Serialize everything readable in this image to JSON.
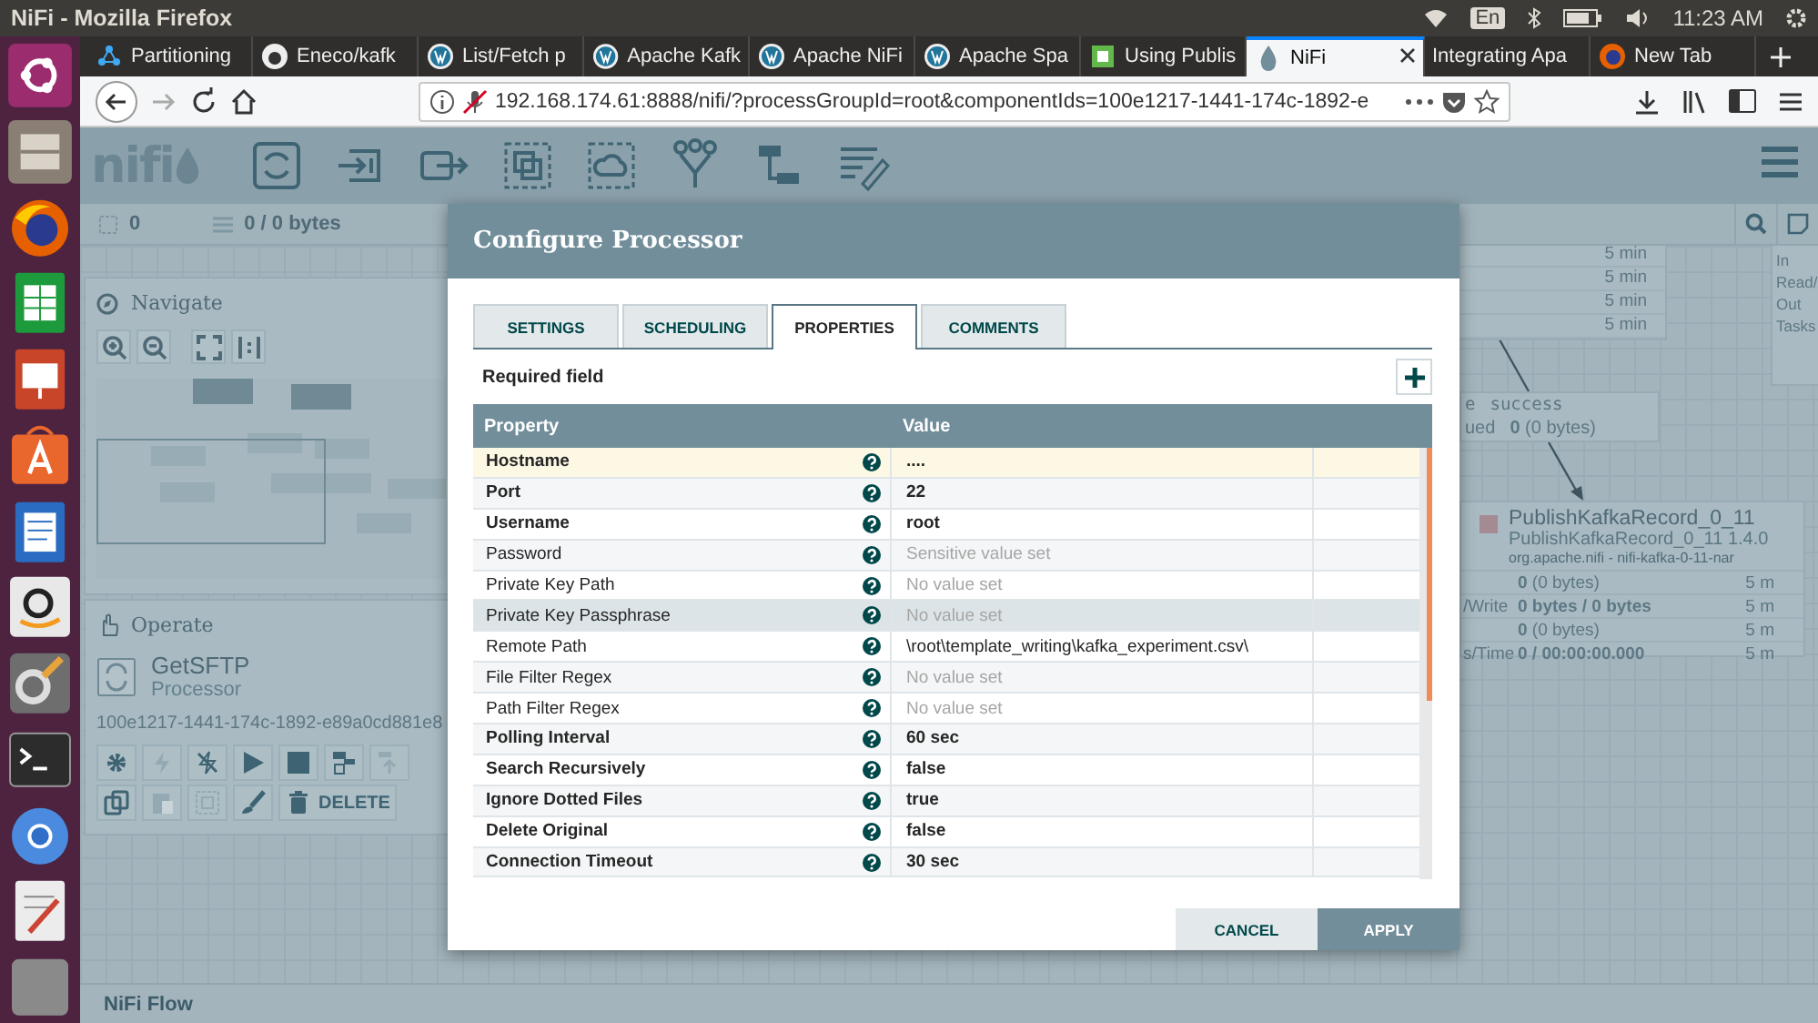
{
  "desktop": {
    "title": "NiFi - Mozilla Firefox",
    "keyboard": "En",
    "time": "11:23 AM"
  },
  "launcher": [
    {
      "kind": "dash"
    },
    {
      "kind": "files"
    },
    {
      "kind": "firefox"
    },
    {
      "kind": "calc"
    },
    {
      "kind": "impress"
    },
    {
      "kind": "software"
    },
    {
      "kind": "writer"
    },
    {
      "kind": "amazon"
    },
    {
      "kind": "settings"
    },
    {
      "kind": "terminal"
    },
    {
      "kind": "chromium"
    },
    {
      "kind": "editor"
    },
    {
      "kind": "trash"
    }
  ],
  "browser": {
    "tabs": [
      {
        "label": "Partitioning",
        "kind": "cluster",
        "selected": false
      },
      {
        "label": "Eneco/kafk",
        "kind": "github",
        "selected": false
      },
      {
        "label": "List/Fetch p",
        "kind": "wordpress",
        "selected": false
      },
      {
        "label": "Apache Kafk",
        "kind": "wordpress",
        "selected": false
      },
      {
        "label": "Apache NiFi",
        "kind": "wordpress",
        "selected": false
      },
      {
        "label": "Apache Spa",
        "kind": "wordpress",
        "selected": false
      },
      {
        "label": "Using Publis",
        "kind": "leaf",
        "selected": false
      },
      {
        "label": "NiFi",
        "kind": "drop",
        "selected": true
      },
      {
        "label": "Integrating Apa",
        "kind": "plain",
        "selected": false
      },
      {
        "label": "New Tab",
        "kind": "firefox",
        "selected": false
      }
    ],
    "url": "192.168.174.61:8888/nifi/?processGroupId=root&componentIds=100e1217-1441-174c-1892-e"
  },
  "nifi": {
    "logo": "nifi",
    "tools": [
      {
        "kind": "processor"
      },
      {
        "kind": "input-port"
      },
      {
        "kind": "output-port"
      },
      {
        "kind": "process-group"
      },
      {
        "kind": "remote-group"
      },
      {
        "kind": "funnel"
      },
      {
        "kind": "template"
      },
      {
        "kind": "label"
      }
    ],
    "stats": [
      {
        "kind": "components",
        "value": "0"
      },
      {
        "kind": "queued",
        "value": "0 / 0 bytes"
      }
    ],
    "navigate": {
      "title": "Navigate",
      "buttons": [
        {
          "kind": "zoom-in"
        },
        {
          "kind": "zoom-out"
        },
        {
          "kind": "fit"
        },
        {
          "kind": "actual-size"
        }
      ]
    },
    "operate": {
      "title": "Operate",
      "component": {
        "name": "GetSFTP",
        "type": "Processor",
        "id": "100e1217-1441-174c-1892-e89a0cd881e8"
      },
      "rows": [
        [
          {
            "kind": "gear",
            "disabled": false
          },
          {
            "kind": "enable",
            "disabled": true
          },
          {
            "kind": "disable",
            "disabled": false
          },
          {
            "kind": "start",
            "disabled": false
          },
          {
            "kind": "stop",
            "disabled": false
          },
          {
            "kind": "template",
            "disabled": false
          },
          {
            "kind": "upload",
            "disabled": true
          }
        ],
        [
          {
            "kind": "copy",
            "disabled": false
          },
          {
            "kind": "paste",
            "disabled": true
          },
          {
            "kind": "group",
            "disabled": true
          },
          {
            "kind": "color",
            "disabled": false
          },
          {
            "kind": "delete",
            "label": "DELETE",
            "disabled": false
          }
        ]
      ]
    },
    "canvas": {
      "top_node": {
        "stats": [
          "5 min",
          "5 min",
          "5 min",
          "5 min"
        ]
      },
      "connection": {
        "name_fragment": "e",
        "name": "success",
        "queued_fragment": "ued",
        "queued": "**0** (0 bytes)"
      },
      "processor": {
        "name": "PublishKafkaRecord_0_11",
        "type": "PublishKafkaRecord_0_11 1.4.0",
        "bundle": "org.apache.nifi - nifi-kafka-0-11-nar",
        "stats": [
          {
            "value": "**0** (0 bytes)",
            "time": "5 m"
          },
          {
            "label": "/Write",
            "value": "**0 bytes / 0 bytes**",
            "time": "5 m"
          },
          {
            "value": "**0** (0 bytes)",
            "time": "5 m"
          },
          {
            "label": "s/Time",
            "value": "**0 / 00:00:00.000**",
            "time": "5 m"
          }
        ]
      },
      "right_node": {
        "labels": [
          "In",
          "Read/",
          "Out",
          "Tasks"
        ]
      }
    },
    "breadcrumb": "NiFi Flow",
    "dialog": {
      "title": "Configure Processor",
      "tabs": [
        {
          "label": "SETTINGS",
          "selected": false
        },
        {
          "label": "SCHEDULING",
          "selected": false
        },
        {
          "label": "PROPERTIES",
          "selected": true
        },
        {
          "label": "COMMENTS",
          "selected": false
        }
      ],
      "required_note": "Required field",
      "columns": [
        "Property",
        "Value"
      ],
      "rows": [
        {
          "property": "Hostname",
          "value": "....",
          "required": true,
          "muted": false,
          "selected": true,
          "hovered": false
        },
        {
          "property": "Port",
          "value": "22",
          "required": true,
          "muted": false,
          "selected": false,
          "hovered": false
        },
        {
          "property": "Username",
          "value": "root",
          "required": true,
          "muted": false,
          "selected": false,
          "hovered": false
        },
        {
          "property": "Password",
          "value": "Sensitive value set",
          "required": false,
          "muted": true,
          "selected": false,
          "hovered": false
        },
        {
          "property": "Private Key Path",
          "value": "No value set",
          "required": false,
          "muted": true,
          "selected": false,
          "hovered": false
        },
        {
          "property": "Private Key Passphrase",
          "value": "No value set",
          "required": false,
          "muted": true,
          "selected": false,
          "hovered": true
        },
        {
          "property": "Remote Path",
          "value": "\\root\\template_writing\\kafka_experiment.csv\\",
          "required": false,
          "muted": false,
          "selected": false,
          "hovered": false
        },
        {
          "property": "File Filter Regex",
          "value": "No value set",
          "required": false,
          "muted": true,
          "selected": false,
          "hovered": false
        },
        {
          "property": "Path Filter Regex",
          "value": "No value set",
          "required": false,
          "muted": true,
          "selected": false,
          "hovered": false
        },
        {
          "property": "Polling Interval",
          "value": "60 sec",
          "required": true,
          "muted": false,
          "selected": false,
          "hovered": false
        },
        {
          "property": "Search Recursively",
          "value": "false",
          "required": true,
          "muted": false,
          "selected": false,
          "hovered": false
        },
        {
          "property": "Ignore Dotted Files",
          "value": "true",
          "required": true,
          "muted": false,
          "selected": false,
          "hovered": false
        },
        {
          "property": "Delete Original",
          "value": "false",
          "required": true,
          "muted": false,
          "selected": false,
          "hovered": false
        },
        {
          "property": "Connection Timeout",
          "value": "30 sec",
          "required": true,
          "muted": false,
          "selected": false,
          "hovered": false
        }
      ],
      "buttons": [
        {
          "label": "CANCEL",
          "kind": "secondary"
        },
        {
          "label": "APPLY",
          "kind": "primary"
        }
      ]
    }
  }
}
